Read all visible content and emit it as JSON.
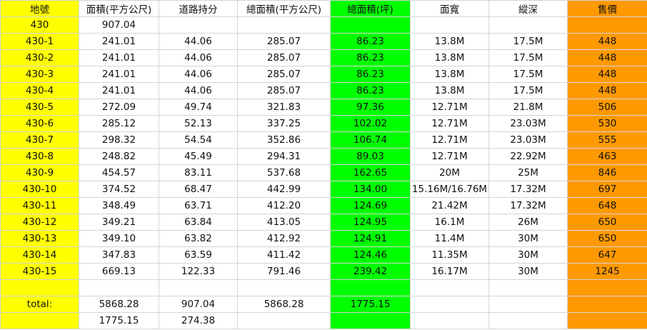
{
  "sheet": {
    "colors": {
      "land_no_column": "#ffff00",
      "total_ping_column": "#00ff00",
      "price_column": "#ff9900",
      "default": "#ffffff",
      "gridline": "#d4d4d4"
    },
    "headers": [
      "地號",
      "面積(平方公尺)",
      "道路持分",
      "總面積(平方公尺)",
      "總面積(坪)",
      "面寬",
      "縱深",
      "售價"
    ],
    "rows": [
      [
        "430",
        "907.04",
        "",
        "",
        "",
        "",
        "",
        ""
      ],
      [
        "430-1",
        "241.01",
        "44.06",
        "285.07",
        "86.23",
        "13.8M",
        "17.5M",
        "448"
      ],
      [
        "430-2",
        "241.01",
        "44.06",
        "285.07",
        "86.23",
        "13.8M",
        "17.5M",
        "448"
      ],
      [
        "430-3",
        "241.01",
        "44.06",
        "285.07",
        "86.23",
        "13.8M",
        "17.5M",
        "448"
      ],
      [
        "430-4",
        "241.01",
        "44.06",
        "285.07",
        "86.23",
        "13.8M",
        "17.5M",
        "448"
      ],
      [
        "430-5",
        "272.09",
        "49.74",
        "321.83",
        "97.36",
        "12.71M",
        "21.8M",
        "506"
      ],
      [
        "430-6",
        "285.12",
        "52.13",
        "337.25",
        "102.02",
        "12.71M",
        "23.03M",
        "530"
      ],
      [
        "430-7",
        "298.32",
        "54.54",
        "352.86",
        "106.74",
        "12.71M",
        "23.03M",
        "555"
      ],
      [
        "430-8",
        "248.82",
        "45.49",
        "294.31",
        "89.03",
        "12.71M",
        "22.92M",
        "463"
      ],
      [
        "430-9",
        "454.57",
        "83.11",
        "537.68",
        "162.65",
        "20M",
        "25M",
        "846"
      ],
      [
        "430-10",
        "374.52",
        "68.47",
        "442.99",
        "134.00",
        "15.16M/16.76M",
        "17.32M",
        "697"
      ],
      [
        "430-11",
        "348.49",
        "63.71",
        "412.20",
        "124.69",
        "21.42M",
        "17.32M",
        "648"
      ],
      [
        "430-12",
        "349.21",
        "63.84",
        "413.05",
        "124.95",
        "16.1M",
        "26M",
        "650"
      ],
      [
        "430-13",
        "349.10",
        "63.82",
        "412.92",
        "124.91",
        "11.4M",
        "30M",
        "650"
      ],
      [
        "430-14",
        "347.83",
        "63.59",
        "411.42",
        "124.46",
        "11.35M",
        "30M",
        "647"
      ],
      [
        "430-15",
        "669.13",
        "122.33",
        "791.46",
        "239.42",
        "16.17M",
        "30M",
        "1245"
      ],
      [
        "",
        "",
        "",
        "",
        "",
        "",
        "",
        ""
      ],
      [
        "total:",
        "5868.28",
        "907.04",
        "5868.28",
        "1775.15",
        "",
        "",
        ""
      ],
      [
        "",
        "1775.15",
        "274.38",
        "",
        "",
        "",
        "",
        ""
      ]
    ]
  }
}
